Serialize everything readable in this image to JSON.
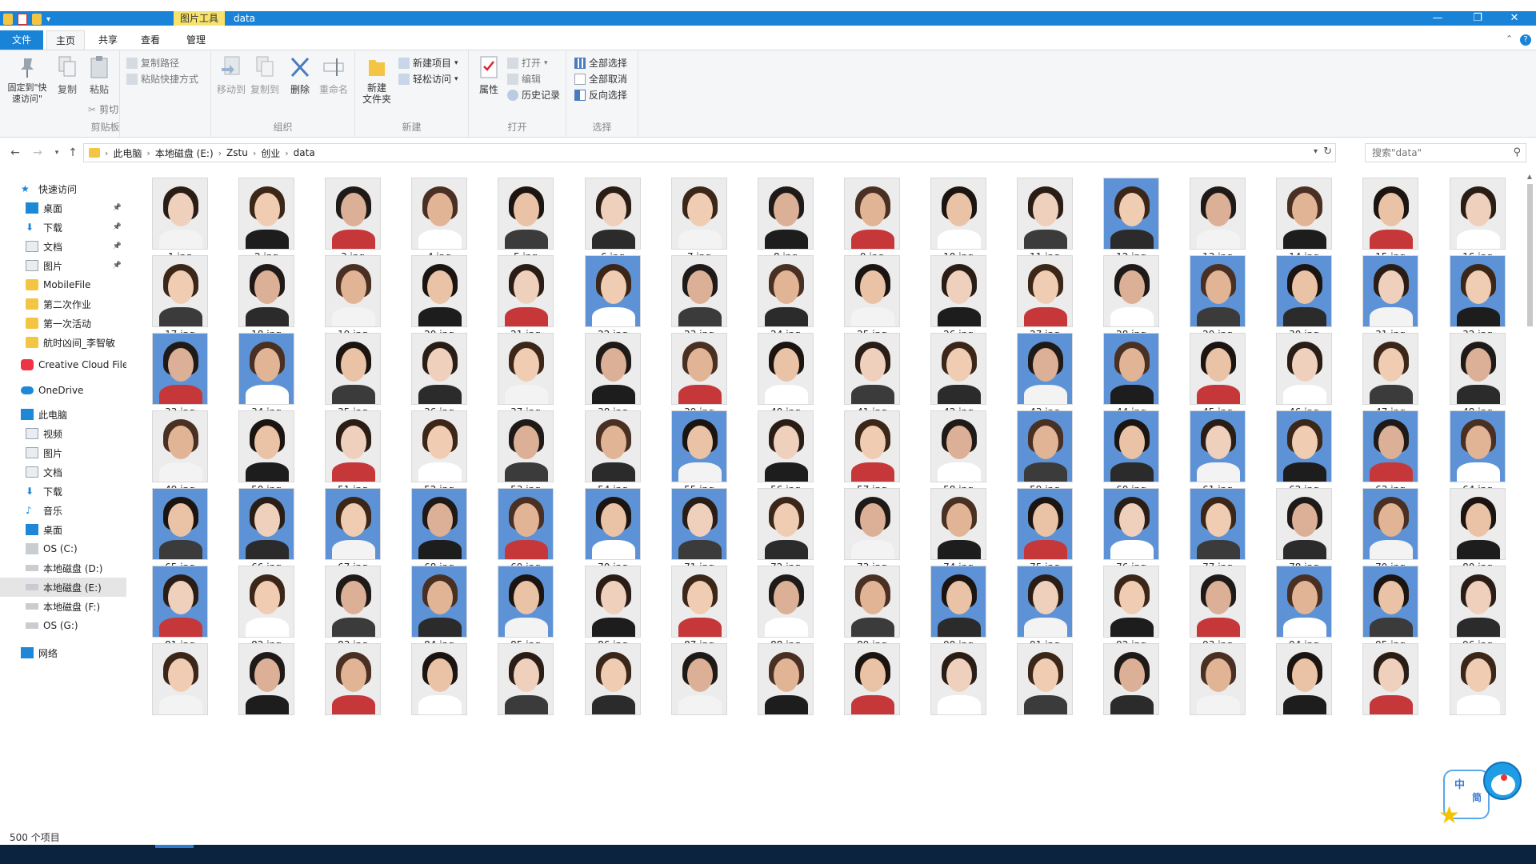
{
  "window": {
    "title": "data",
    "context_tab": "图片工具",
    "controls": {
      "minimize": "—",
      "maximize": "❐",
      "close": "✕"
    }
  },
  "ribbon_tabs": [
    {
      "label": "文件"
    },
    {
      "label": "主页"
    },
    {
      "label": "共享"
    },
    {
      "label": "查看"
    },
    {
      "label": "管理"
    }
  ],
  "ribbon": {
    "clipboard": {
      "group_label": "剪贴板",
      "pin_label": "固定到\"快速访问\"",
      "copy_label": "复制",
      "paste_label": "粘贴",
      "copy_path_label": "复制路径",
      "paste_shortcut_label": "粘贴快捷方式",
      "cut_label": "剪切"
    },
    "organize": {
      "group_label": "组织",
      "move_to_label": "移动到",
      "copy_to_label": "复制到",
      "delete_label": "删除",
      "rename_label": "重命名"
    },
    "new": {
      "group_label": "新建",
      "new_folder_label": "新建\n文件夹",
      "new_item_label": "新建项目",
      "easy_access_label": "轻松访问"
    },
    "open": {
      "group_label": "打开",
      "properties_label": "属性",
      "open_label": "打开",
      "edit_label": "编辑",
      "history_label": "历史记录"
    },
    "select": {
      "group_label": "选择",
      "select_all_label": "全部选择",
      "select_none_label": "全部取消",
      "invert_label": "反向选择"
    }
  },
  "address": {
    "breadcrumbs": [
      "此电脑",
      "本地磁盘 (E:)",
      "Zstu",
      "创业",
      "data"
    ],
    "search_placeholder": "搜索\"data\""
  },
  "navpane": {
    "items": [
      {
        "label": "快速访问",
        "icon": "star-icon",
        "level": 0,
        "pinned": false,
        "selected": false
      },
      {
        "label": "桌面",
        "icon": "desktop-icon",
        "level": 1,
        "pinned": true,
        "selected": false
      },
      {
        "label": "下载",
        "icon": "download-icon",
        "level": 1,
        "pinned": true,
        "selected": false
      },
      {
        "label": "文档",
        "icon": "document-icon",
        "level": 1,
        "pinned": true,
        "selected": false
      },
      {
        "label": "图片",
        "icon": "pictures-icon",
        "level": 1,
        "pinned": true,
        "selected": false
      },
      {
        "label": "MobileFile",
        "icon": "folder-icon",
        "level": 1,
        "pinned": false,
        "selected": false
      },
      {
        "label": "第二次作业",
        "icon": "folder-icon",
        "level": 1,
        "pinned": false,
        "selected": false
      },
      {
        "label": "第一次活动",
        "icon": "folder-icon",
        "level": 1,
        "pinned": false,
        "selected": false
      },
      {
        "label": "航时凶间_李智敏",
        "icon": "folder-icon",
        "level": 1,
        "pinned": false,
        "selected": false
      },
      {
        "label": "Creative Cloud Files",
        "icon": "creative-cloud-icon",
        "level": 0,
        "pinned": false,
        "selected": false
      },
      {
        "label": "OneDrive",
        "icon": "cloud-icon",
        "level": 0,
        "pinned": false,
        "selected": false
      },
      {
        "label": "此电脑",
        "icon": "computer-icon",
        "level": 0,
        "pinned": false,
        "selected": false
      },
      {
        "label": "视频",
        "icon": "video-icon",
        "level": 1,
        "pinned": false,
        "selected": false
      },
      {
        "label": "图片",
        "icon": "pictures-icon",
        "level": 1,
        "pinned": false,
        "selected": false
      },
      {
        "label": "文档",
        "icon": "document-icon",
        "level": 1,
        "pinned": false,
        "selected": false
      },
      {
        "label": "下载",
        "icon": "download-icon",
        "level": 1,
        "pinned": false,
        "selected": false
      },
      {
        "label": "音乐",
        "icon": "music-icon",
        "level": 1,
        "pinned": false,
        "selected": false
      },
      {
        "label": "桌面",
        "icon": "desktop-icon",
        "level": 1,
        "pinned": false,
        "selected": false
      },
      {
        "label": "OS (C:)",
        "icon": "os-drive-icon",
        "level": 1,
        "pinned": false,
        "selected": false
      },
      {
        "label": "本地磁盘 (D:)",
        "icon": "drive-icon",
        "level": 1,
        "pinned": false,
        "selected": false
      },
      {
        "label": "本地磁盘 (E:)",
        "icon": "drive-icon",
        "level": 1,
        "pinned": false,
        "selected": true
      },
      {
        "label": "本地磁盘 (F:)",
        "icon": "drive-icon",
        "level": 1,
        "pinned": false,
        "selected": false
      },
      {
        "label": "OS (G:)",
        "icon": "drive-icon",
        "level": 1,
        "pinned": false,
        "selected": false
      },
      {
        "label": "网络",
        "icon": "network-icon",
        "level": 0,
        "pinned": false,
        "selected": false
      }
    ]
  },
  "files": {
    "first_number": 1,
    "visible_count": 112,
    "extension": ".jpg",
    "blue_background_numbers": [
      12,
      22,
      29,
      30,
      31,
      32,
      33,
      34,
      43,
      44,
      55,
      59,
      60,
      61,
      62,
      63,
      64,
      65,
      66,
      67,
      68,
      69,
      70,
      71,
      75,
      76,
      77,
      79,
      81,
      84,
      85,
      90,
      91,
      94,
      95
    ]
  },
  "status": {
    "item_count_label": "500 个项目"
  },
  "ime": {
    "char1": "中",
    "char2": "简"
  },
  "colors": {
    "accent": "#1883d7",
    "context_tab": "#f7e36b",
    "blue_photo_bg": "#5d93d6",
    "light_photo_bg": "#ececec"
  }
}
